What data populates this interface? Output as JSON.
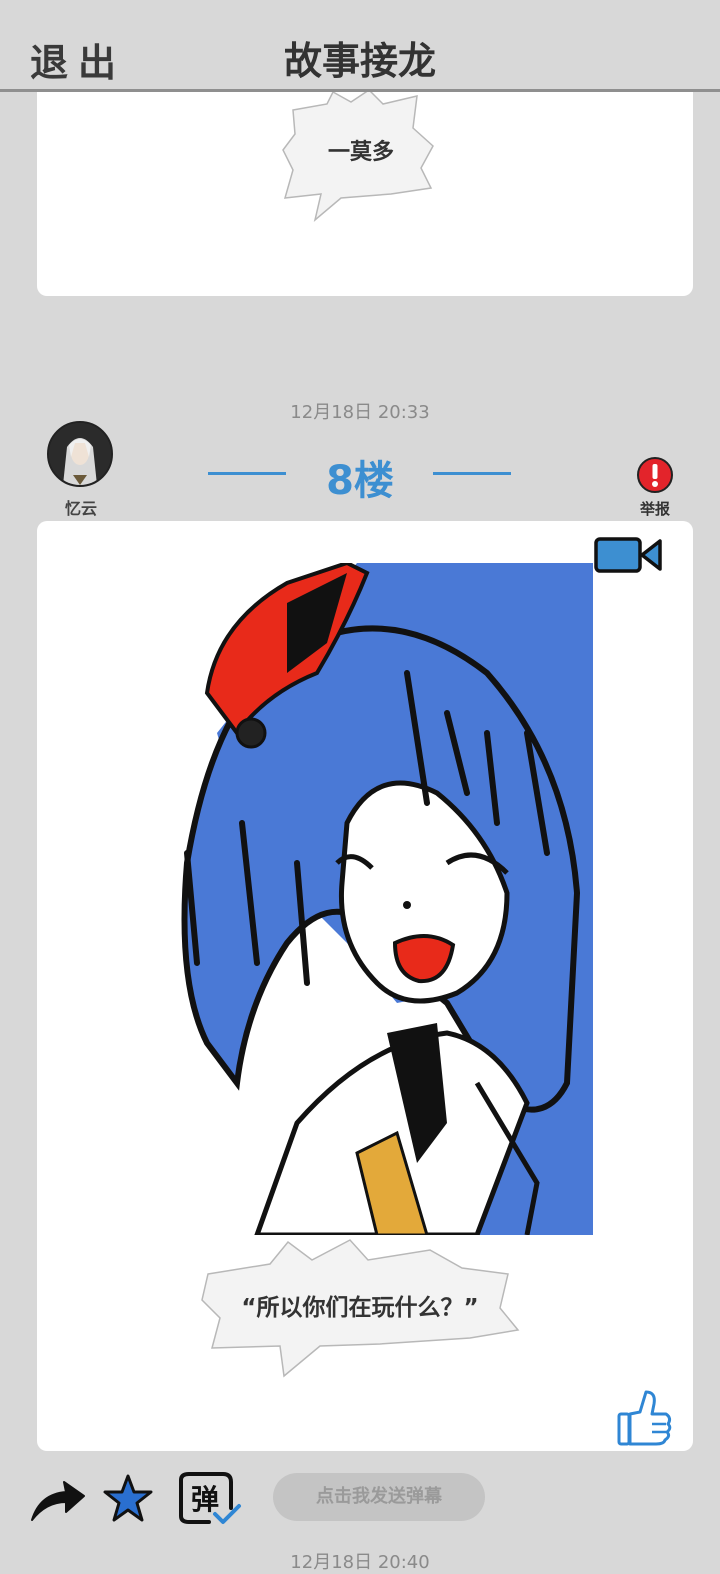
{
  "header": {
    "exit_label": "退出",
    "title": "故事接龙"
  },
  "previous_post": {
    "caption": "一莫多"
  },
  "post": {
    "time": "12月18日  20:33",
    "author": "忆云",
    "floor": "8楼",
    "report_label": "举报",
    "caption": "“所以你们在玩什么？”"
  },
  "actions": {
    "danmu_icon_text": "弹",
    "danmu_button": "点击我发送弹幕"
  },
  "next_post": {
    "time": "12月18日  20:40"
  },
  "icons": {
    "share": "share-arrow-icon",
    "favorite": "star-icon",
    "danmu": "danmu-icon",
    "video": "video-camera-icon",
    "like": "thumbs-up-icon",
    "report": "exclamation-icon"
  },
  "colors": {
    "accent": "#3d8fd1",
    "report": "#e3242b",
    "background": "#d8d8d8"
  }
}
